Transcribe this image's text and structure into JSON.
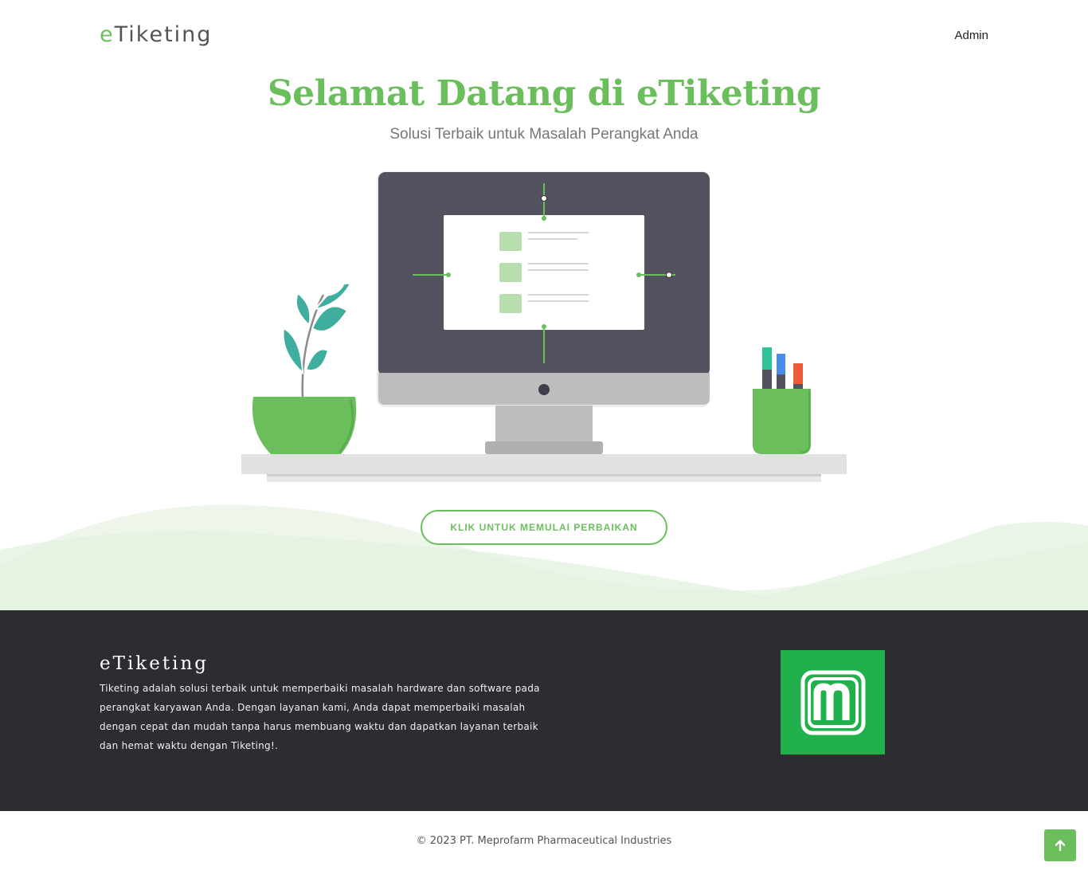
{
  "header": {
    "logo_prefix": "e",
    "logo_rest": "Tiketing",
    "nav_admin": "Admin"
  },
  "hero": {
    "title": "Selamat Datang di eTiketing",
    "subtitle": "Solusi Terbaik untuk Masalah Perangkat Anda",
    "cta_label": "KLIK UNTUK MEMULAI PERBAIKAN"
  },
  "footer": {
    "brand": "eTiketing",
    "description": "Tiketing adalah solusi terbaik untuk memperbaiki masalah hardware dan software pada perangkat karyawan Anda. Dengan layanan kami, Anda dapat memperbaiki masalah dengan cepat dan mudah tanpa harus membuang waktu dan dapatkan layanan terbaik dan hemat waktu dengan Tiketing!.",
    "logo_icon": "meprofarm-m-logo"
  },
  "copyright": "© 2023 PT. Meprofarm Pharmaceutical Industries",
  "back_to_top_icon": "arrow-up-icon",
  "colors": {
    "accent": "#6abf5c",
    "footer_bg": "#2c2c31",
    "logo_green": "#21b04b"
  }
}
